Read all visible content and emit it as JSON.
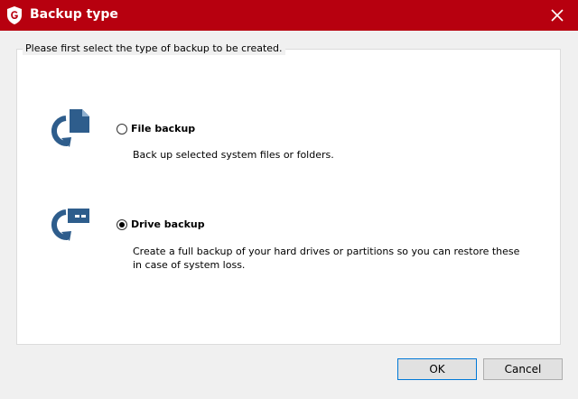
{
  "window": {
    "title": "Backup type",
    "accent_color": "#b7000f"
  },
  "group": {
    "legend": "Please first select the type of backup to be created."
  },
  "options": [
    {
      "label": "File backup",
      "description": "Back up selected system files or folders.",
      "selected": false,
      "icon": "file-backup-icon"
    },
    {
      "label": "Drive backup",
      "description_line1": "Create a full backup of your hard drives or partitions so you can restore these",
      "description_line2": "in case of system loss.",
      "selected": true,
      "icon": "drive-backup-icon"
    }
  ],
  "buttons": {
    "ok": "OK",
    "cancel": "Cancel"
  }
}
